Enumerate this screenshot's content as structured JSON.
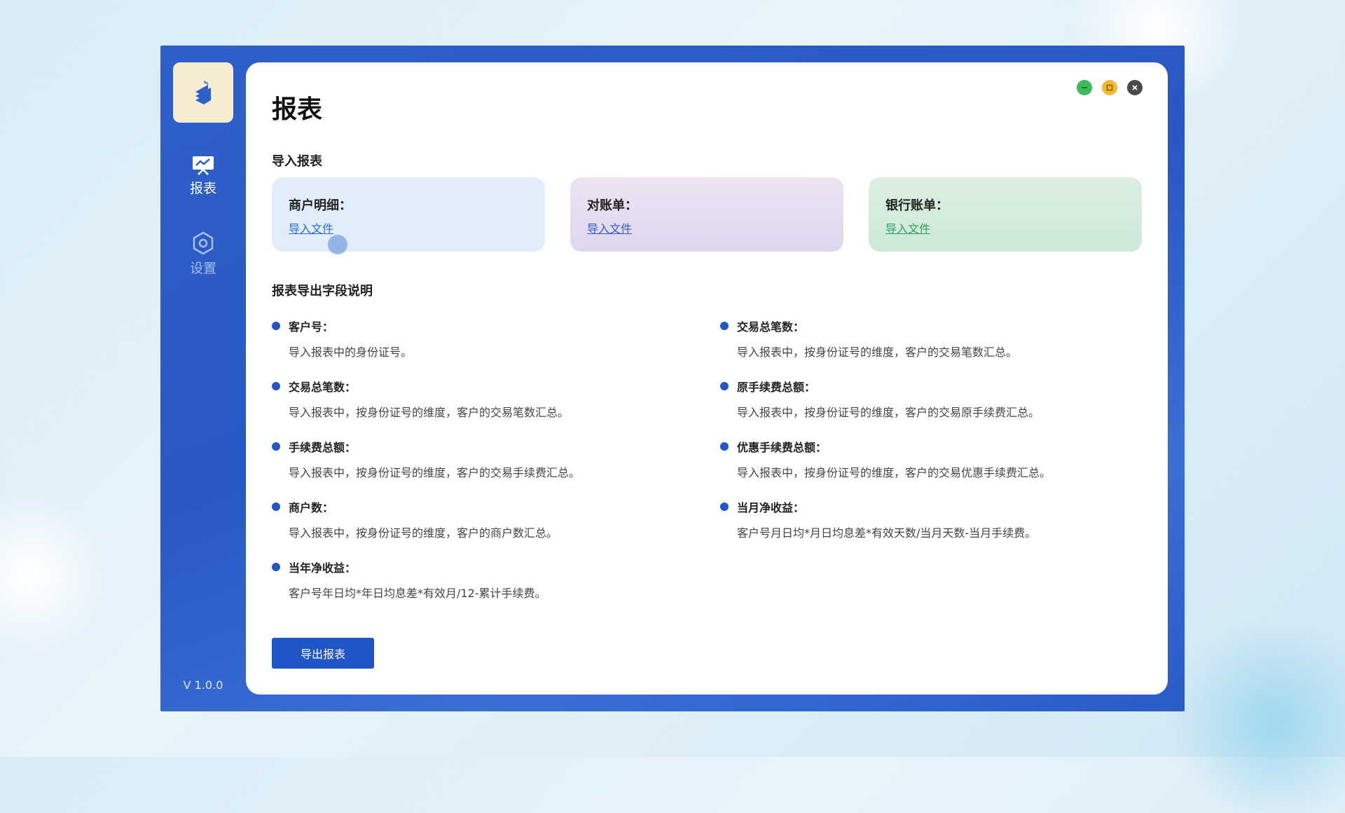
{
  "app": {
    "version": "V 1.0.0",
    "accent": "#2a58c4"
  },
  "sidebar": {
    "items": [
      {
        "label": "报表",
        "icon": "chart-board-icon",
        "active": true
      },
      {
        "label": "设置",
        "icon": "hexagon-settings-icon",
        "active": false
      }
    ]
  },
  "window_controls": [
    "minimize-icon",
    "maximize-icon",
    "close-icon"
  ],
  "page": {
    "title": "报表"
  },
  "import_section": {
    "title": "导入报表",
    "cards": [
      {
        "label": "商户明细：",
        "link": "导入文件"
      },
      {
        "label": "对账单：",
        "link": "导入文件"
      },
      {
        "label": "银行账单：",
        "link": "导入文件"
      }
    ]
  },
  "fields_section": {
    "title": "报表导出字段说明",
    "left": [
      {
        "name": "客户号：",
        "desc": "导入报表中的身份证号。"
      },
      {
        "name": "交易总笔数：",
        "desc": "导入报表中，按身份证号的维度，客户的交易笔数汇总。"
      },
      {
        "name": "手续费总额：",
        "desc": "导入报表中，按身份证号的维度，客户的交易手续费汇总。"
      },
      {
        "name": "商户数：",
        "desc": "导入报表中，按身份证号的维度，客户的商户数汇总。"
      },
      {
        "name": "当年净收益：",
        "desc": "客户号年日均*年日均息差*有效月/12-累计手续费。"
      }
    ],
    "right": [
      {
        "name": "交易总笔数：",
        "desc": "导入报表中，按身份证号的维度，客户的交易笔数汇总。"
      },
      {
        "name": "原手续费总额：",
        "desc": "导入报表中，按身份证号的维度，客户的交易原手续费汇总。"
      },
      {
        "name": "优惠手续费总额：",
        "desc": "导入报表中，按身份证号的维度，客户的交易优惠手续费汇总。"
      },
      {
        "name": "当月净收益：",
        "desc": "客户号月日均*月日均息差*有效天数/当月天数-当月手续费。"
      }
    ]
  },
  "actions": {
    "export_label": "导出报表"
  }
}
